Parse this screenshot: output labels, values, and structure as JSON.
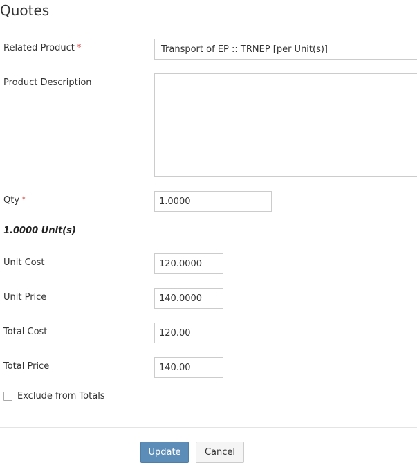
{
  "dialog": {
    "title": "Quotes"
  },
  "form": {
    "related_product": {
      "label": "Related Product",
      "required_mark": "*",
      "value": "Transport of EP :: TRNEP [per Unit(s)]"
    },
    "product_description": {
      "label": "Product Description",
      "value": ""
    },
    "qty": {
      "label": "Qty",
      "required_mark": "*",
      "value": "1.0000"
    },
    "units_summary": "1.0000 Unit(s)",
    "unit_cost": {
      "label": "Unit Cost",
      "value": "120.0000"
    },
    "unit_price": {
      "label": "Unit Price",
      "value": "140.0000"
    },
    "total_cost": {
      "label": "Total Cost",
      "value": "120.00"
    },
    "total_price": {
      "label": "Total Price",
      "value": "140.00"
    },
    "exclude_from_totals": {
      "label": "Exclude from Totals",
      "checked": false
    }
  },
  "actions": {
    "update_label": "Update",
    "cancel_label": "Cancel"
  },
  "colors": {
    "primary_button": "#5b8db8",
    "required_asterisk": "#d9534f",
    "border": "#cccccc"
  }
}
